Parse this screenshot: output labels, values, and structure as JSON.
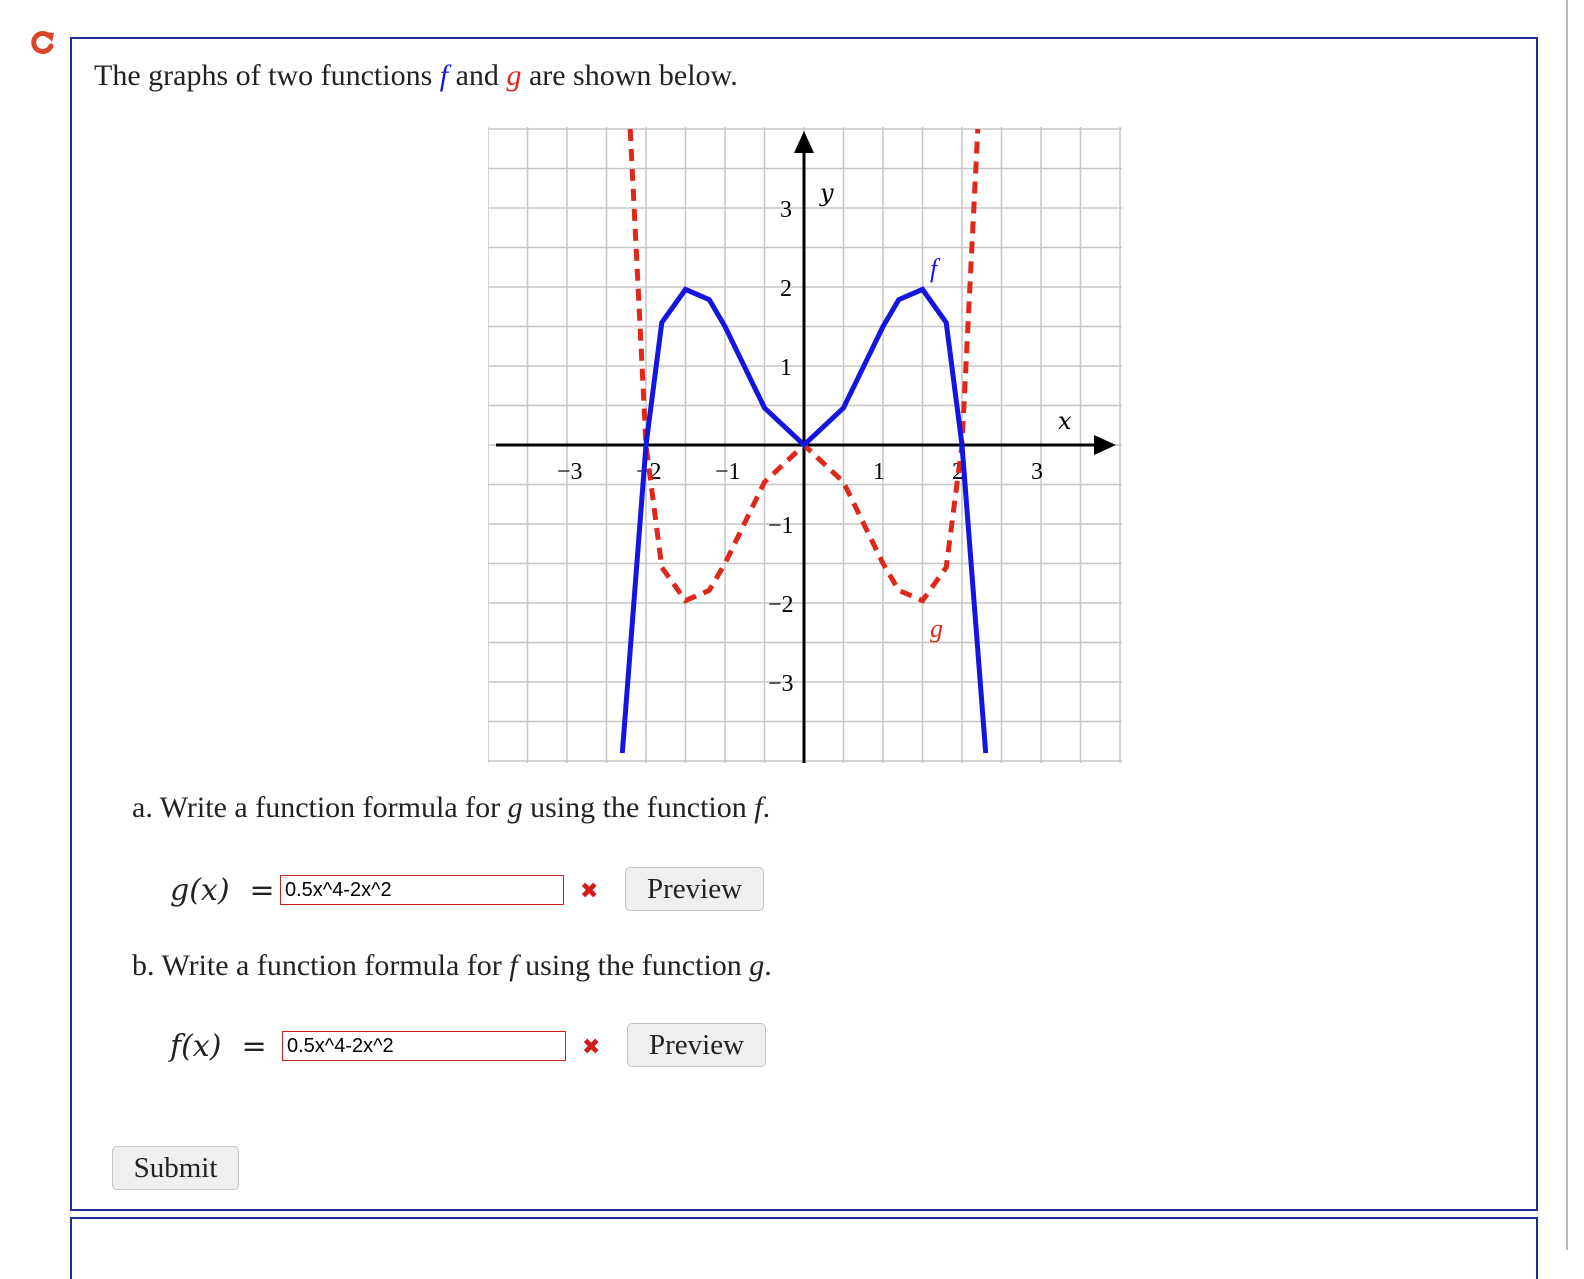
{
  "question": {
    "text_before": "The graphs of two functions ",
    "f_symbol": "f",
    "and_text": " and ",
    "g_symbol": "g",
    "text_after": " are shown below."
  },
  "graph": {
    "x_axis_label": "x",
    "y_axis_label": "y",
    "x_tick_labels": [
      "−3",
      "−2",
      "−1",
      "1",
      "2",
      "3"
    ],
    "y_tick_labels": [
      "3",
      "2",
      "1",
      "−1",
      "−2",
      "−3"
    ],
    "curve_f_label": "f",
    "curve_g_label": "g",
    "colors": {
      "f": "#1515e0",
      "g": "#e0271c",
      "grid": "#c6c6c6",
      "axis": "#000000"
    }
  },
  "chart_data": {
    "type": "line",
    "title": "",
    "xlabel": "x",
    "ylabel": "y",
    "xlim": [
      -3.9,
      3.9
    ],
    "ylim": [
      -3.9,
      4.0
    ],
    "grid": true,
    "series": [
      {
        "name": "f",
        "style": "solid",
        "color": "#1515e0",
        "x": [
          -2.3,
          -2,
          -1.8,
          -1.5,
          -1.2,
          -1,
          -0.5,
          0,
          0.5,
          1,
          1.2,
          1.5,
          1.8,
          2,
          2.3
        ],
        "y": [
          -3.9,
          0,
          1.55,
          1.97,
          1.84,
          1.5,
          0.47,
          0,
          0.47,
          1.5,
          1.84,
          1.97,
          1.55,
          0,
          -3.9
        ]
      },
      {
        "name": "g",
        "style": "dashed",
        "color": "#e0271c",
        "x": [
          -2.2,
          -2,
          -1.8,
          -1.5,
          -1.2,
          -1,
          -0.5,
          0,
          0.5,
          1,
          1.2,
          1.5,
          1.8,
          2,
          2.2
        ],
        "y": [
          4.0,
          0,
          -1.55,
          -1.97,
          -1.84,
          -1.5,
          -0.47,
          0,
          -0.47,
          -1.5,
          -1.84,
          -1.97,
          -1.55,
          0,
          4.0
        ]
      }
    ]
  },
  "part_a": {
    "label": "a.",
    "text_before": "Write a function formula for ",
    "var": "g",
    "text_mid": " using the function ",
    "var2": "f",
    "text_after": ".",
    "formula_lhs": "g(x)",
    "equals": "=",
    "answer": "0.5x^4-2x^2",
    "status_icon": "✖",
    "preview_label": "Preview"
  },
  "part_b": {
    "label": "b.",
    "text_before": "Write a function formula for ",
    "var": "f",
    "text_mid": " using the function ",
    "var2": "g",
    "text_after": ".",
    "formula_lhs": "f(x)",
    "equals": "=",
    "answer": "0.5x^4-2x^2",
    "status_icon": "✖",
    "preview_label": "Preview"
  },
  "submit_label": "Submit"
}
